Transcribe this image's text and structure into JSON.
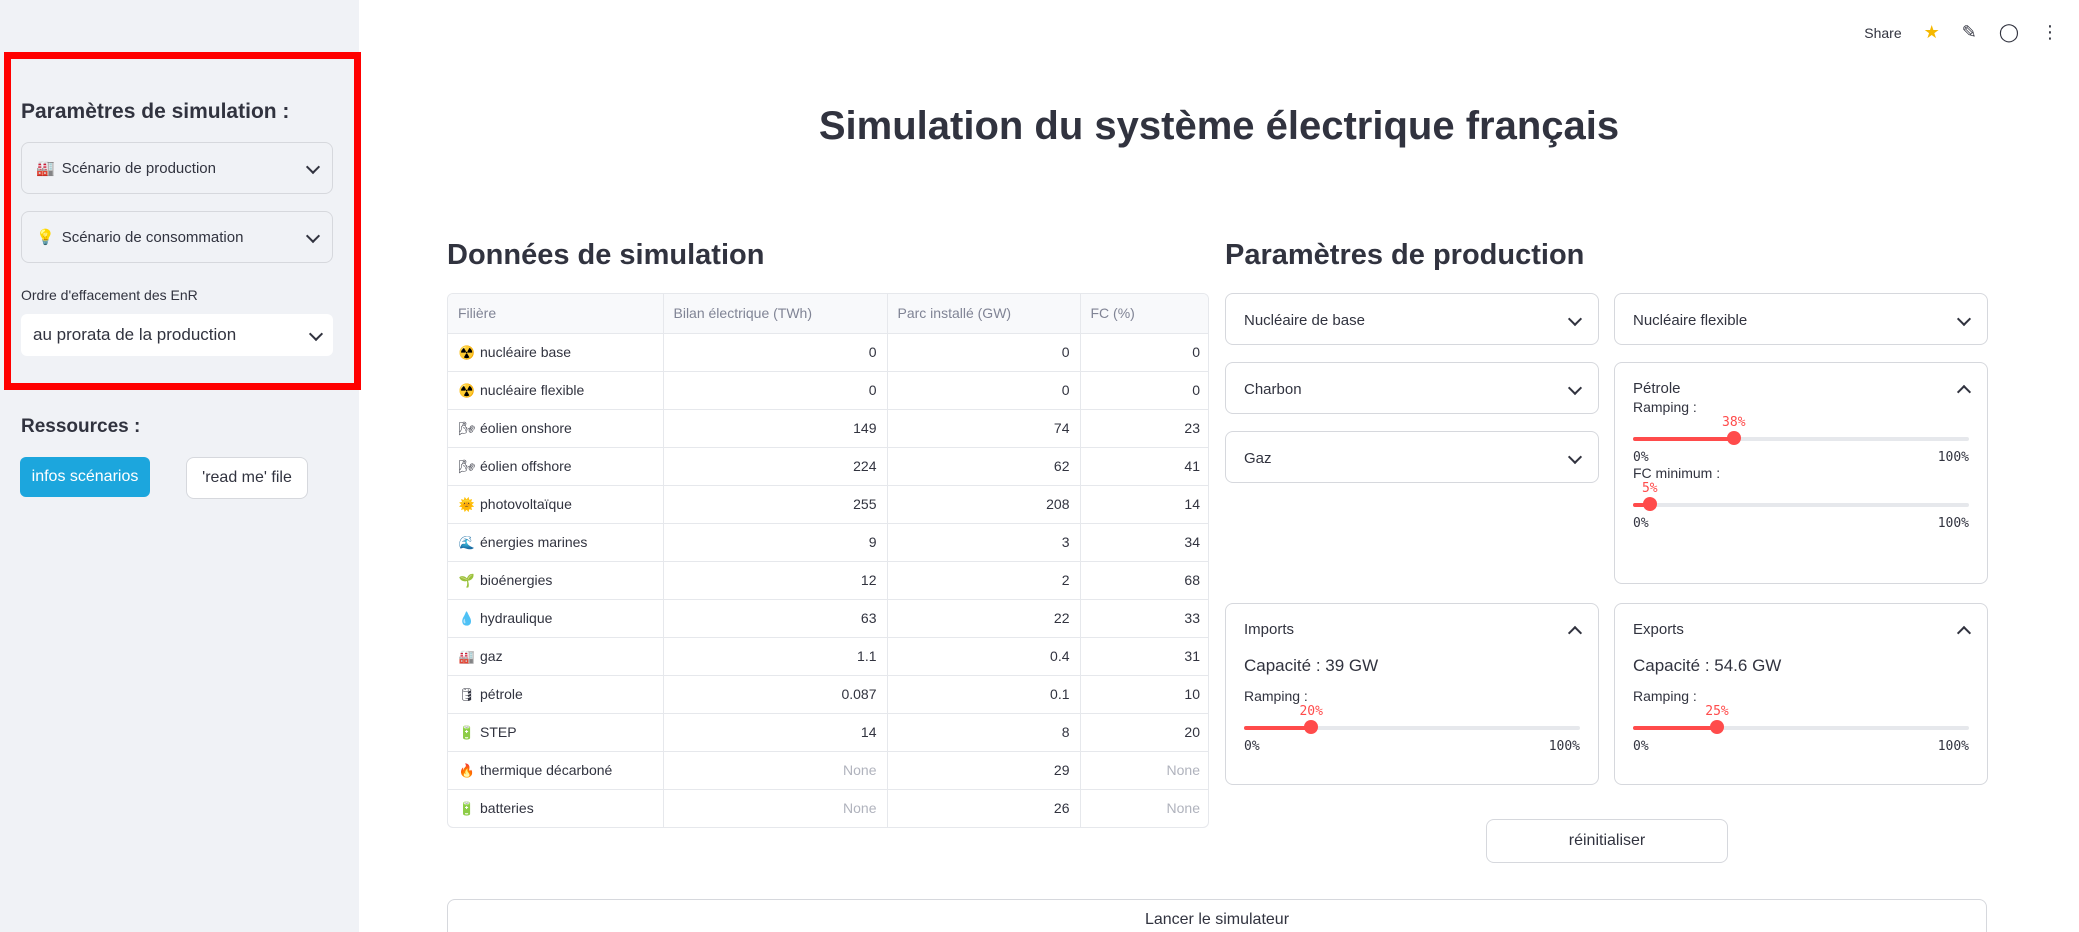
{
  "toolbar": {
    "share": "Share",
    "icons": [
      "star-icon",
      "pencil-icon",
      "github-icon",
      "more-icon"
    ]
  },
  "sidebar": {
    "heading": "Paramètres de simulation :",
    "production_expander": {
      "emoji": "🏭",
      "label": "Scénario de production"
    },
    "consumption_expander": {
      "emoji": "💡",
      "label": "Scénario de consommation"
    },
    "order_label": "Ordre d'effacement des EnR",
    "order_value": "au prorata de la production",
    "resources_heading": "Ressources :",
    "btn_info": "infos scénarios",
    "btn_readme": "'read me' file"
  },
  "main": {
    "title": "Simulation du système électrique français",
    "data_title": "Données de simulation",
    "params_title": "Paramètres de production"
  },
  "table": {
    "headers": [
      "Filière",
      "Bilan électrique (TWh)",
      "Parc installé (GW)",
      "FC (%)"
    ],
    "rows": [
      {
        "icon": "☢️",
        "name": "nucléaire base",
        "bilan": "0",
        "parc": "0",
        "fc": "0"
      },
      {
        "icon": "☢️",
        "name": "nucléaire flexible",
        "bilan": "0",
        "parc": "0",
        "fc": "0"
      },
      {
        "icon": "🌬",
        "name": "éolien onshore",
        "bilan": "149",
        "parc": "74",
        "fc": "23"
      },
      {
        "icon": "🌬",
        "name": "éolien offshore",
        "bilan": "224",
        "parc": "62",
        "fc": "41"
      },
      {
        "icon": "🌞",
        "name": "photovoltaïque",
        "bilan": "255",
        "parc": "208",
        "fc": "14"
      },
      {
        "icon": "🌊",
        "name": "énergies marines",
        "bilan": "9",
        "parc": "3",
        "fc": "34"
      },
      {
        "icon": "🌱",
        "name": "bioénergies",
        "bilan": "12",
        "parc": "2",
        "fc": "68"
      },
      {
        "icon": "💧",
        "name": "hydraulique",
        "bilan": "63",
        "parc": "22",
        "fc": "33"
      },
      {
        "icon": "🏭",
        "name": "gaz",
        "bilan": "1.1",
        "parc": "0.4",
        "fc": "31"
      },
      {
        "icon": "🛢",
        "name": "pétrole",
        "bilan": "0.087",
        "parc": "0.1",
        "fc": "10"
      },
      {
        "icon": "🔋",
        "name": "STEP",
        "bilan": "14",
        "parc": "8",
        "fc": "20"
      },
      {
        "icon": "🔥",
        "name": "thermique décarboné",
        "bilan": "None",
        "parc": "29",
        "fc": "None"
      },
      {
        "icon": "🔋",
        "name": "batteries",
        "bilan": "None",
        "parc": "26",
        "fc": "None"
      }
    ]
  },
  "params": {
    "nucleaire_base": "Nucléaire de base",
    "nucleaire_flexible": "Nucléaire flexible",
    "charbon": "Charbon",
    "gaz": "Gaz",
    "petrole": {
      "title": "Pétrole",
      "ramping_label": "Ramping :",
      "ramping_value": "38%",
      "ramping_level": 0.3,
      "fcmin_label": "FC minimum :",
      "fcmin_value": "5%",
      "fcmin_level": 0.05,
      "min": "0%",
      "max": "100%"
    },
    "imports": {
      "title": "Imports",
      "capacity": "Capacité : 39 GW",
      "ramping_label": "Ramping :",
      "ramping_value": "20%",
      "ramping_level": 0.2,
      "min": "0%",
      "max": "100%"
    },
    "exports": {
      "title": "Exports",
      "capacity": "Capacité : 54.6 GW",
      "ramping_label": "Ramping :",
      "ramping_value": "25%",
      "ramping_level": 0.25,
      "min": "0%",
      "max": "100%"
    }
  },
  "buttons": {
    "reset": "réinitialiser",
    "launch": "Lancer le simulateur"
  },
  "colors": {
    "accent": "#ff4b4b",
    "primary_button": "#1ca6dd",
    "sidebar_bg": "#f0f2f6",
    "highlight": "#ff0000"
  }
}
